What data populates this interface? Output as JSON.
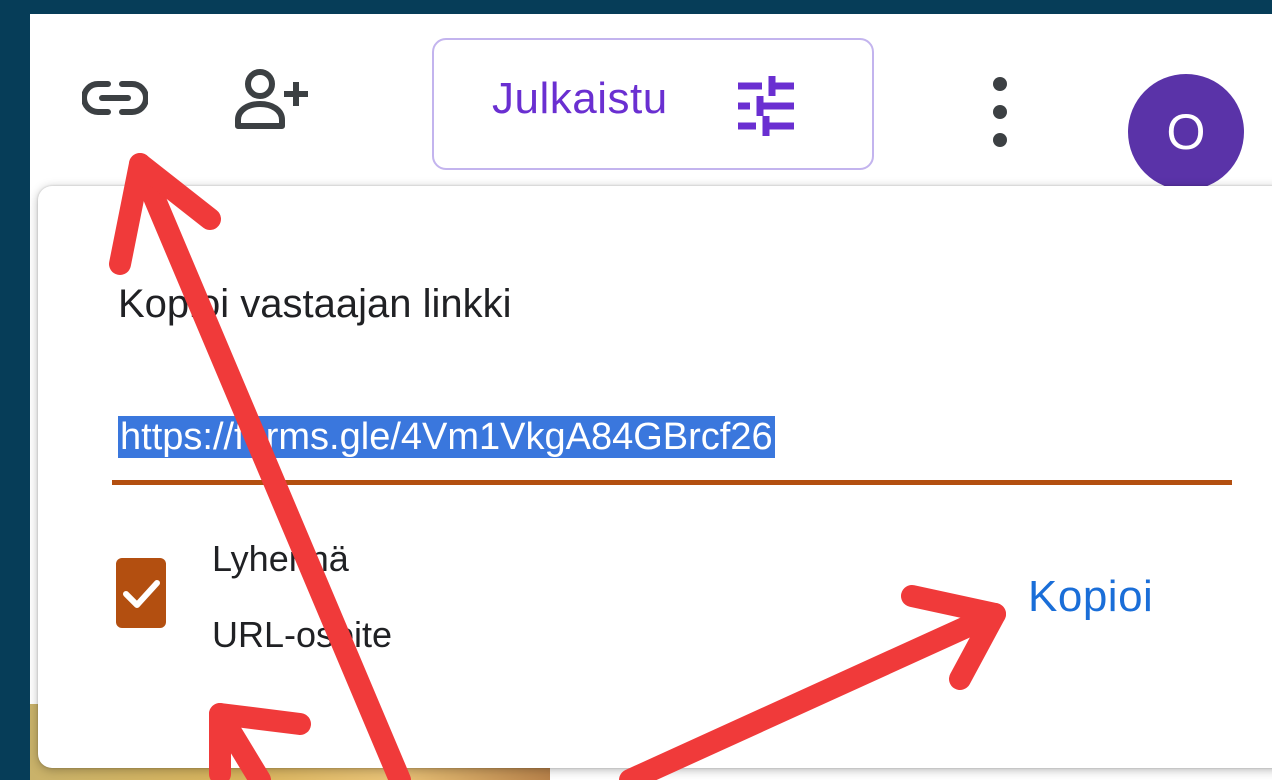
{
  "toolbar": {
    "link_icon": "link-icon",
    "add_person_icon": "add-person-icon",
    "publish_label": "Julkaistu",
    "publish_icon": "tune-icon",
    "more_icon": "more-vert-icon",
    "avatar_initial": "O"
  },
  "popup": {
    "title": "Kopioi vastaajan linkki",
    "link_value": "https://forms.gle/4Vm1VkgA84GBrcf26",
    "checkbox_label_line1": "Lyhennä",
    "checkbox_label_line2": "URL-osoite",
    "checkbox_checked": true,
    "copy_label": "Kopioi"
  },
  "colors": {
    "accent_purple": "#6a2fd1",
    "avatar_bg": "#5a33a8",
    "accent_orange": "#b34f10",
    "copy_blue": "#1a6ed8",
    "annotation_red": "#f03a3a"
  }
}
